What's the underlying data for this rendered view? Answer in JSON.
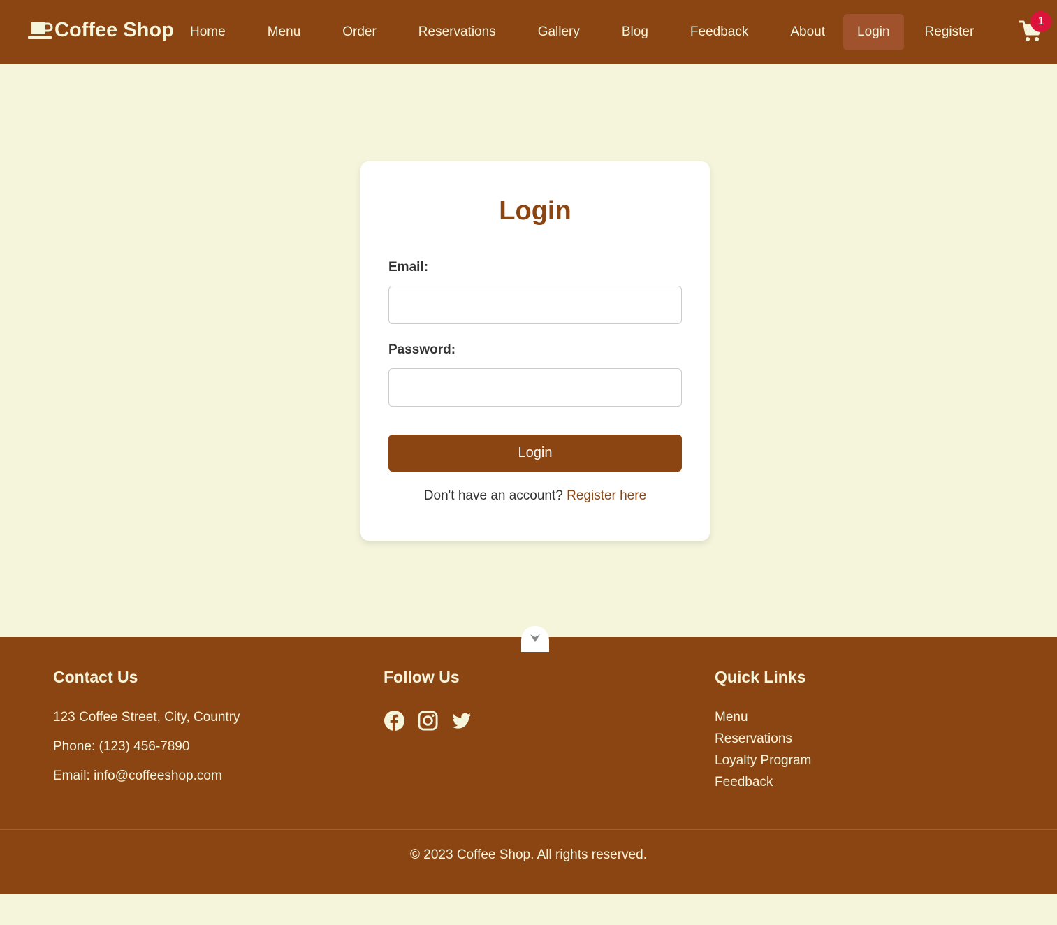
{
  "header": {
    "brand": "Coffee Shop",
    "nav": [
      {
        "label": "Home"
      },
      {
        "label": "Menu"
      },
      {
        "label": "Order"
      },
      {
        "label": "Reservations"
      },
      {
        "label": "Gallery"
      },
      {
        "label": "Blog"
      },
      {
        "label": "Feedback"
      },
      {
        "label": "About"
      },
      {
        "label": "Login",
        "active": true
      },
      {
        "label": "Register"
      }
    ],
    "cart_count": "1"
  },
  "login": {
    "title": "Login",
    "email_label": "Email:",
    "email_value": "",
    "password_label": "Password:",
    "password_value": "",
    "button": "Login",
    "no_account_text": "Don't have an account?",
    "register_link": "Register here"
  },
  "footer": {
    "contact": {
      "heading": "Contact Us",
      "address": "123 Coffee Street, City, Country",
      "phone": "Phone: (123) 456-7890",
      "email": "Email: info@coffeeshop.com"
    },
    "follow": {
      "heading": "Follow Us",
      "icons": [
        "facebook-icon",
        "instagram-icon",
        "twitter-icon"
      ]
    },
    "quick_links": {
      "heading": "Quick Links",
      "items": [
        "Menu",
        "Reservations",
        "Loyalty Program",
        "Feedback"
      ]
    },
    "copyright": "© 2023 Coffee Shop. All rights reserved."
  },
  "colors": {
    "brand_brown": "#8b4513",
    "active_nav": "#a0522d",
    "page_bg": "#f5f5dc",
    "badge": "#dc143c"
  }
}
